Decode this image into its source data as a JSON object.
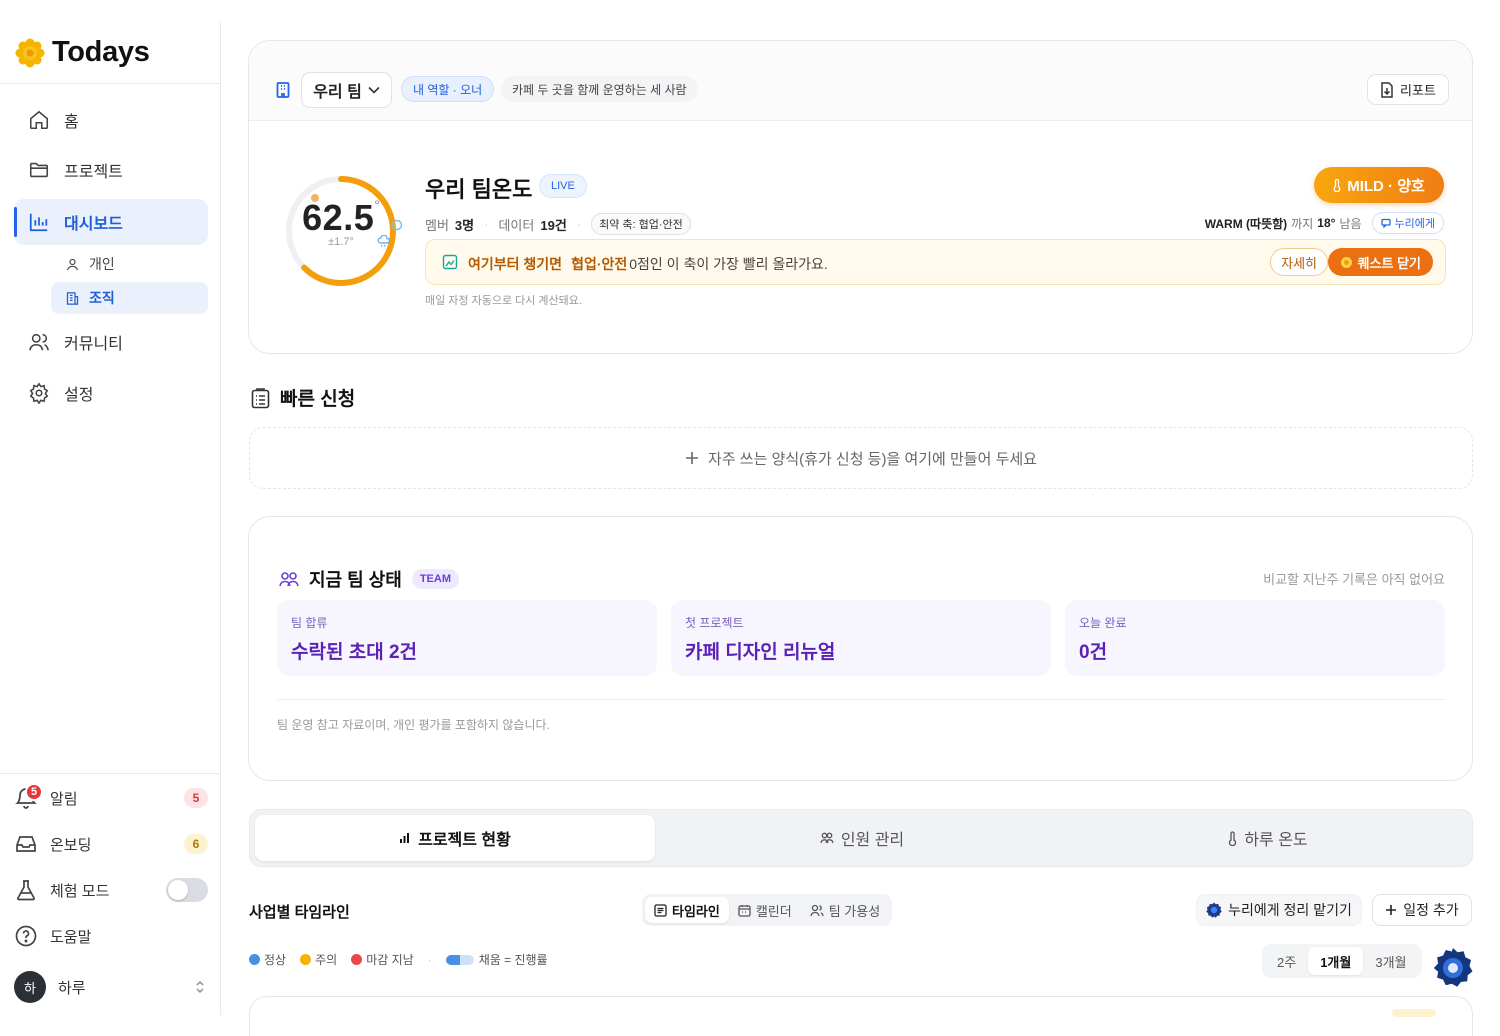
{
  "app": {
    "name": "Todays"
  },
  "sidebar": {
    "items": [
      {
        "label": "홈",
        "icon": "home-icon"
      },
      {
        "label": "프로젝트",
        "icon": "folder-icon"
      },
      {
        "label": "대시보드",
        "icon": "bar-chart-icon",
        "active": true
      },
      {
        "label": "커뮤니티",
        "icon": "users-icon"
      },
      {
        "label": "설정",
        "icon": "gear-icon"
      }
    ],
    "subitems": [
      {
        "label": "개인",
        "icon": "user-icon"
      },
      {
        "label": "조직",
        "icon": "building-icon",
        "active": true
      }
    ],
    "bottom": {
      "alerts": {
        "label": "알림",
        "count": "5",
        "badge": "5"
      },
      "onboarding": {
        "label": "온보딩",
        "count": "6"
      },
      "trial_mode": {
        "label": "체험 모드",
        "enabled": false
      },
      "help": {
        "label": "도움말"
      },
      "user": {
        "avatar": "하",
        "name": "하루"
      }
    }
  },
  "header": {
    "team_select": "우리 팀",
    "role_pill": "내 역할 · 오너",
    "desc_pill": "카페 두 곳을 함께 운영하는 세 사람",
    "report_button": "리포트"
  },
  "temperature": {
    "value": "62.5",
    "unit": "°",
    "delta": "±1.7°",
    "gauge_fraction": 0.625,
    "title": "우리 팀온도",
    "live": "LIVE",
    "members_label": "멤버",
    "members_value": "3명",
    "data_label": "데이터",
    "data_value": "19건",
    "weakest_axis": "최약 축: 협업·안전",
    "status_badge": "MILD · 양호",
    "warm_text_bold": "WARM (따뜻함)",
    "warm_text_mid": "까지",
    "warm_text_value": "18°",
    "warm_text_end": "남음",
    "nuri_button": "누리에게",
    "quest_prefix": "여기부터 챙기면",
    "quest_axis": "협업·안전",
    "quest_text": "0점인 이 축이 가장 빨리 올라가요.",
    "quest_detail_button": "자세히",
    "quest_close_button": "퀘스트 닫기",
    "recalc_note": "매일 자정 자동으로 다시 계산돼요."
  },
  "quick_request": {
    "title": "빠른 신청",
    "add_text": "자주 쓰는 양식(휴가 신청 등)을 여기에 만들어 두세요"
  },
  "team_status": {
    "title": "지금 팀 상태",
    "badge": "TEAM",
    "compare_note": "비교할 지난주 기록은 아직 없어요",
    "stats": [
      {
        "label": "팀 합류",
        "value": "수락된 초대 2건"
      },
      {
        "label": "첫 프로젝트",
        "value": "카페 디자인 리뉴얼"
      },
      {
        "label": "오늘 완료",
        "value": "0건"
      }
    ],
    "footnote": "팀 운영 참고 자료이며, 개인 평가를 포함하지 않습니다."
  },
  "tabs": [
    {
      "label": "프로젝트 현황",
      "icon": "bar-chart-icon",
      "active": true
    },
    {
      "label": "인원 관리",
      "icon": "people-icon"
    },
    {
      "label": "하루 온도",
      "icon": "thermometer-icon"
    }
  ],
  "timeline": {
    "title": "사업별 타임라인",
    "views": [
      {
        "label": "타임라인",
        "icon": "list-icon",
        "active": true
      },
      {
        "label": "캘린더",
        "icon": "calendar-icon"
      },
      {
        "label": "팀 가용성",
        "icon": "users-icon"
      }
    ],
    "nuri_button": "누리에게 정리 맡기기",
    "add_button": "일정 추가",
    "legend": [
      {
        "label": "정상",
        "color": "#4a90e2"
      },
      {
        "label": "주의",
        "color": "#f5b400"
      },
      {
        "label": "마감 지남",
        "color": "#e5484d"
      }
    ],
    "fill_legend": "채움 = 진행률",
    "ranges": [
      {
        "label": "2주"
      },
      {
        "label": "1개월",
        "active": true
      },
      {
        "label": "3개월"
      }
    ]
  },
  "colors": {
    "accent": "#2563eb",
    "orange": "#f59e0b",
    "purple": "#5b21b6"
  }
}
